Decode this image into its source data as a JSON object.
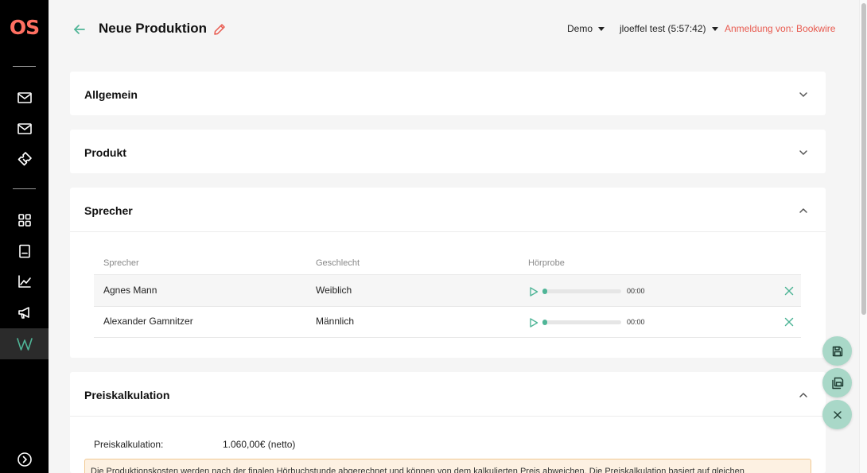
{
  "sidebar": {
    "logo": "OS",
    "items": [
      {
        "name": "mail-icon"
      },
      {
        "name": "mail-icon"
      },
      {
        "name": "ticket-icon"
      },
      {
        "name": "grid-icon"
      },
      {
        "name": "document-icon"
      },
      {
        "name": "chart-icon"
      },
      {
        "name": "megaphone-icon"
      },
      {
        "name": "w-logo-icon",
        "active": true
      },
      {
        "name": "expand-icon"
      }
    ],
    "colors": {
      "background": "#000000",
      "active_background": "#2b2b2b",
      "accent": "#4fb597",
      "logo": "#ff6f61"
    }
  },
  "header": {
    "title": "Neue Produktion",
    "account_select": "Demo",
    "user_session": "jloeffel test (5:57:42)",
    "login_info": "Anmeldung von: Bookwire"
  },
  "panels": {
    "allgemein": {
      "title": "Allgemein",
      "expanded": false
    },
    "produkt": {
      "title": "Produkt",
      "expanded": false
    },
    "sprecher": {
      "title": "Sprecher",
      "expanded": true,
      "columns": [
        "Sprecher",
        "Geschlecht",
        "Hörprobe"
      ],
      "rows": [
        {
          "name": "Agnes Mann",
          "gender": "Weiblich",
          "time": "00:00",
          "progress": 0
        },
        {
          "name": "Alexander Gamnitzer",
          "gender": "Männlich",
          "time": "00:00",
          "progress": 0
        }
      ]
    },
    "preiskalkulation": {
      "title": "Preiskalkulation",
      "expanded": true,
      "label": "Preiskalkulation:",
      "value": "1.060,00€ (netto)",
      "notice": "Die Produktionskosten werden nach der finalen Hörbuchstunde abgerechnet und können von dem kalkulierten Preis abweichen. Die Preiskalkulation basiert auf gleichen"
    }
  },
  "actions": [
    {
      "name": "save-icon"
    },
    {
      "name": "save-copy-icon"
    },
    {
      "name": "close-icon"
    }
  ],
  "colors": {
    "accent": "#4fb597",
    "warning": "#e85a4f",
    "fab": "#a9d8c8",
    "notice_bg": "#fdf1e2",
    "notice_border": "#f1c892"
  }
}
